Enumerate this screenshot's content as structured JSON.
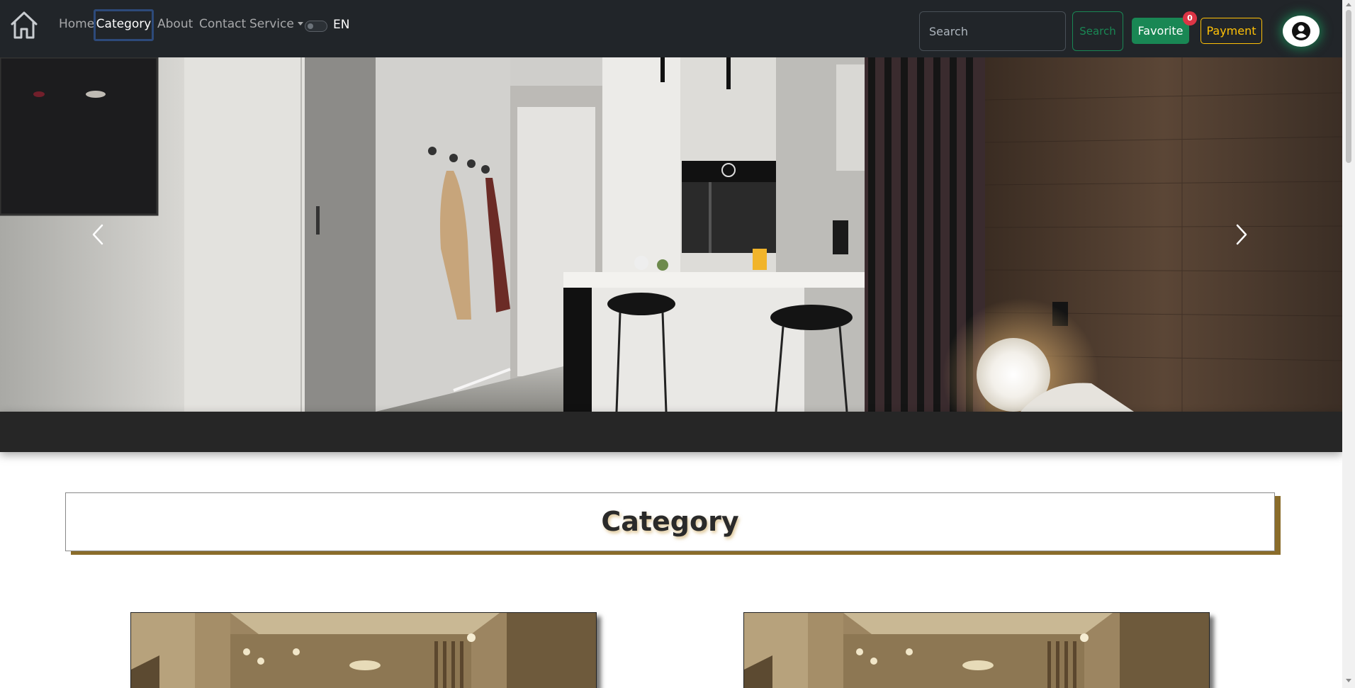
{
  "navbar": {
    "logo_icon": "home-icon",
    "links": {
      "home": "Home",
      "category": "Category",
      "about": "About",
      "contact": "Contact",
      "service": "Service"
    },
    "language": "EN",
    "search": {
      "placeholder": "Search",
      "button": "Search"
    },
    "favorite": {
      "label": "Favorite",
      "count": "0"
    },
    "payment": {
      "label": "Payment"
    },
    "user_icon": "user-circle-icon"
  },
  "carousel": {
    "prev_icon": "chevron-left-icon",
    "next_icon": "chevron-right-icon"
  },
  "section": {
    "title": "Category"
  },
  "colors": {
    "navbar_bg": "#212529",
    "success": "#198754",
    "warning": "#ffc107",
    "danger": "#dc3545",
    "gold_accent": "#8a6c2a"
  }
}
